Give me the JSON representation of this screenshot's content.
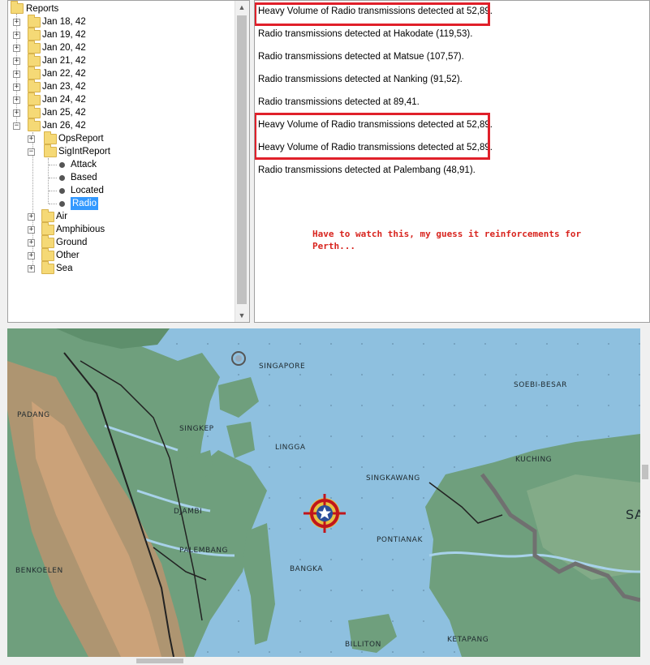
{
  "tree": {
    "root": "Reports",
    "dates": [
      "Jan 18, 42",
      "Jan 19, 42",
      "Jan 20, 42",
      "Jan 21, 42",
      "Jan 22, 42",
      "Jan 23, 42",
      "Jan 24, 42",
      "Jan 25, 42",
      "Jan 26, 42"
    ],
    "jan26_children": {
      "ops": "OpsReport",
      "sigint": "SigIntReport",
      "sigint_items": [
        "Attack",
        "Based",
        "Located",
        "Radio"
      ],
      "others": [
        "Air",
        "Amphibious",
        "Ground",
        "Other",
        "Sea"
      ]
    }
  },
  "messages": [
    "Heavy Volume of Radio transmissions detected at 52,89.",
    "Radio transmissions detected at Hakodate (119,53).",
    "Radio transmissions detected at Matsue (107,57).",
    "Radio transmissions detected at Nanking (91,52).",
    "Radio transmissions detected at 89,41.",
    "Heavy Volume of Radio transmissions detected at 52,89.",
    "Heavy Volume of Radio transmissions detected at 52,89.",
    "Radio transmissions detected at Palembang (48,91)."
  ],
  "note": {
    "line1": "Have to watch this, my guess it reinforcements for",
    "line2": "Perth..."
  },
  "map": {
    "labels": {
      "singapore": "SINGAPORE",
      "soebi": "SOEBI-BESAR",
      "padang": "PADANG",
      "singkep": "SINGKEP",
      "lingga": "LINGGA",
      "kuching": "KUCHING",
      "singkawang": "SINGKAWANG",
      "djambi": "DJAMBI",
      "pontianak": "PONTIANAK",
      "palembang": "PALEMBANG",
      "benkoelen": "BENKOELEN",
      "bangka": "BANGKA",
      "ketapang": "KETAPANG",
      "billiton": "BILLITON",
      "sa": "SA"
    },
    "colors": {
      "sea": "#8ec0df",
      "land": "#6f9f7d",
      "highland": "#c49a6c",
      "highlight": "#e0202a"
    },
    "marker_icon": "target-star-icon"
  }
}
